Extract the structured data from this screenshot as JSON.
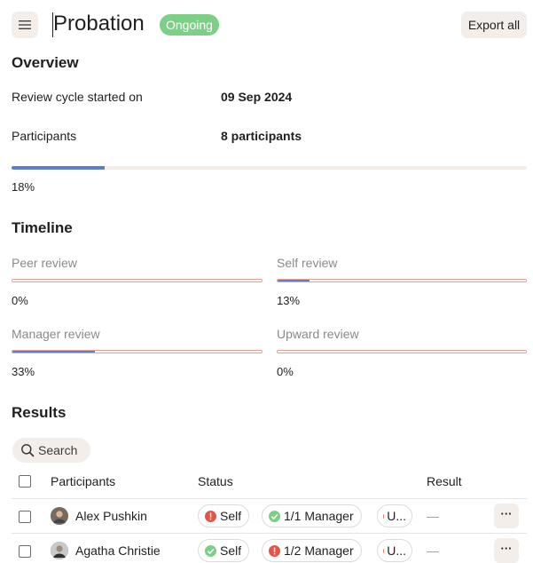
{
  "header": {
    "title": "Probation",
    "status_badge": "Ongoing",
    "export_label": "Export all",
    "menu_icon": "hamburger-icon"
  },
  "overview": {
    "heading": "Overview",
    "cycle_label": "Review cycle started on",
    "cycle_value": "09 Sep 2024",
    "participants_label": "Participants",
    "participants_value": "8 participants",
    "progress_percent": 18,
    "progress_text": "18%"
  },
  "timeline": {
    "heading": "Timeline",
    "items": [
      {
        "label": "Peer review",
        "percent": 0,
        "text": "0%"
      },
      {
        "label": "Self review",
        "percent": 13,
        "text": "13%"
      },
      {
        "label": "Manager review",
        "percent": 33,
        "text": "33%"
      },
      {
        "label": "Upward review",
        "percent": 0,
        "text": "0%"
      }
    ]
  },
  "results": {
    "heading": "Results",
    "search_placeholder": "Search",
    "columns": {
      "participants": "Participants",
      "status": "Status",
      "result": "Result"
    },
    "rows": [
      {
        "name": "Alex Pushkin",
        "self": {
          "label": "Self",
          "state": "alert"
        },
        "manager": {
          "label": "1/1 Manager",
          "state": "done"
        },
        "upward": {
          "label": "U..."
        },
        "result": "—",
        "more": "···"
      },
      {
        "name": "Agatha Christie",
        "self": {
          "label": "Self",
          "state": "done"
        },
        "manager": {
          "label": "1/2 Manager",
          "state": "alert"
        },
        "upward": {
          "label": "U..."
        },
        "result": "—",
        "more": "···"
      }
    ]
  },
  "colors": {
    "accent": "#5c7fcb",
    "success": "#7ccf87",
    "danger": "#e0574a",
    "track_outline": "#e6a196",
    "button_bg": "#f3eeea"
  }
}
